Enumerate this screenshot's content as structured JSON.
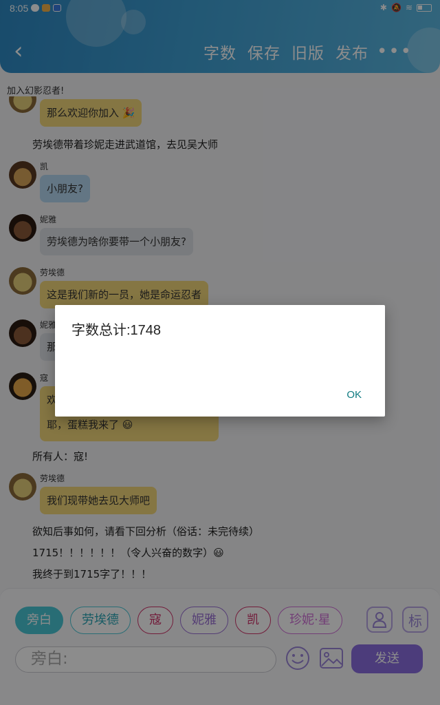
{
  "status": {
    "time": "8:05"
  },
  "header": {
    "actions": [
      "字数",
      "保存",
      "旧版",
      "发布"
    ],
    "more": "•••"
  },
  "system_notice": "加入幻影忍者!",
  "messages": [
    {
      "type": "bubble",
      "color": "yellow",
      "text": "那么欢迎你加入 🎉",
      "avatar": "avatar-lloyd"
    },
    {
      "type": "narration",
      "text": "劳埃德带着珍妮走进武道馆，去见吴大师"
    },
    {
      "type": "bubble",
      "color": "blue",
      "sender": "凯",
      "text": "小朋友?",
      "avatar": "avatar-kai"
    },
    {
      "type": "bubble",
      "color": "grey",
      "sender": "妮雅",
      "text": "劳埃德为啥你要带一个小朋友?",
      "avatar": "avatar-nya"
    },
    {
      "type": "bubble",
      "color": "yellow",
      "sender": "劳埃德",
      "text": "这是我们新的一员，她是命运忍者",
      "avatar": "avatar-lloyd"
    },
    {
      "type": "bubble",
      "color": "grey",
      "sender": "妮雅",
      "text": "那",
      "avatar": "avatar-nya"
    },
    {
      "type": "bubble",
      "color": "yellow",
      "sender": "寇",
      "text": "欢",
      "text2": "耶，蛋糕我来了 😃",
      "avatar": "avatar-cole"
    },
    {
      "type": "narration",
      "text": "所有人：寇!"
    },
    {
      "type": "bubble",
      "color": "yellow",
      "sender": "劳埃德",
      "text": "我们现带她去见大师吧",
      "avatar": "avatar-lloyd"
    },
    {
      "type": "narration",
      "text": "欲知后事如何，请看下回分析（俗话：未完待续）"
    },
    {
      "type": "narration",
      "text": "1715！！！！！！（令人兴奋的数字）😃"
    },
    {
      "type": "narration",
      "text": "我终于到1715字了！！！"
    }
  ],
  "composer": {
    "roles": [
      {
        "label": "旁白",
        "color": "#49c6d6",
        "active": true
      },
      {
        "label": "劳埃德",
        "color": "#49c6d6",
        "active": false
      },
      {
        "label": "寇",
        "color": "#d0336b",
        "active": false
      },
      {
        "label": "妮雅",
        "color": "#9a6fd6",
        "active": false
      },
      {
        "label": "凯",
        "color": "#d0336b",
        "active": false
      },
      {
        "label": "珍妮·星",
        "color": "#d070d8",
        "active": false
      }
    ],
    "tag_button": "标",
    "input_placeholder": "旁白:",
    "send": "发送"
  },
  "dialog": {
    "message": "字数总计:1748",
    "ok": "OK"
  }
}
